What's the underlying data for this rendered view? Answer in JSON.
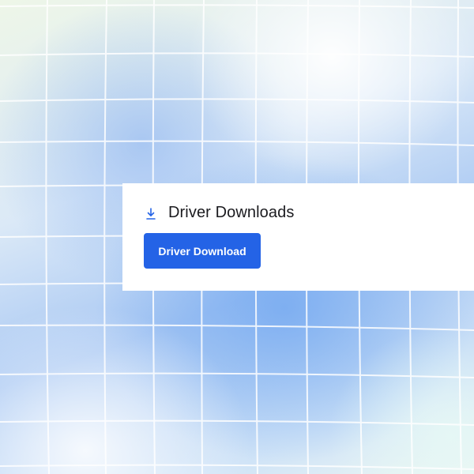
{
  "card": {
    "title": "Driver Downloads",
    "title_icon": "download-icon",
    "button_label": "Driver Download"
  },
  "colors": {
    "accent": "#2463e6",
    "card_background": "#ffffff",
    "title_text": "#1b1b1f"
  }
}
